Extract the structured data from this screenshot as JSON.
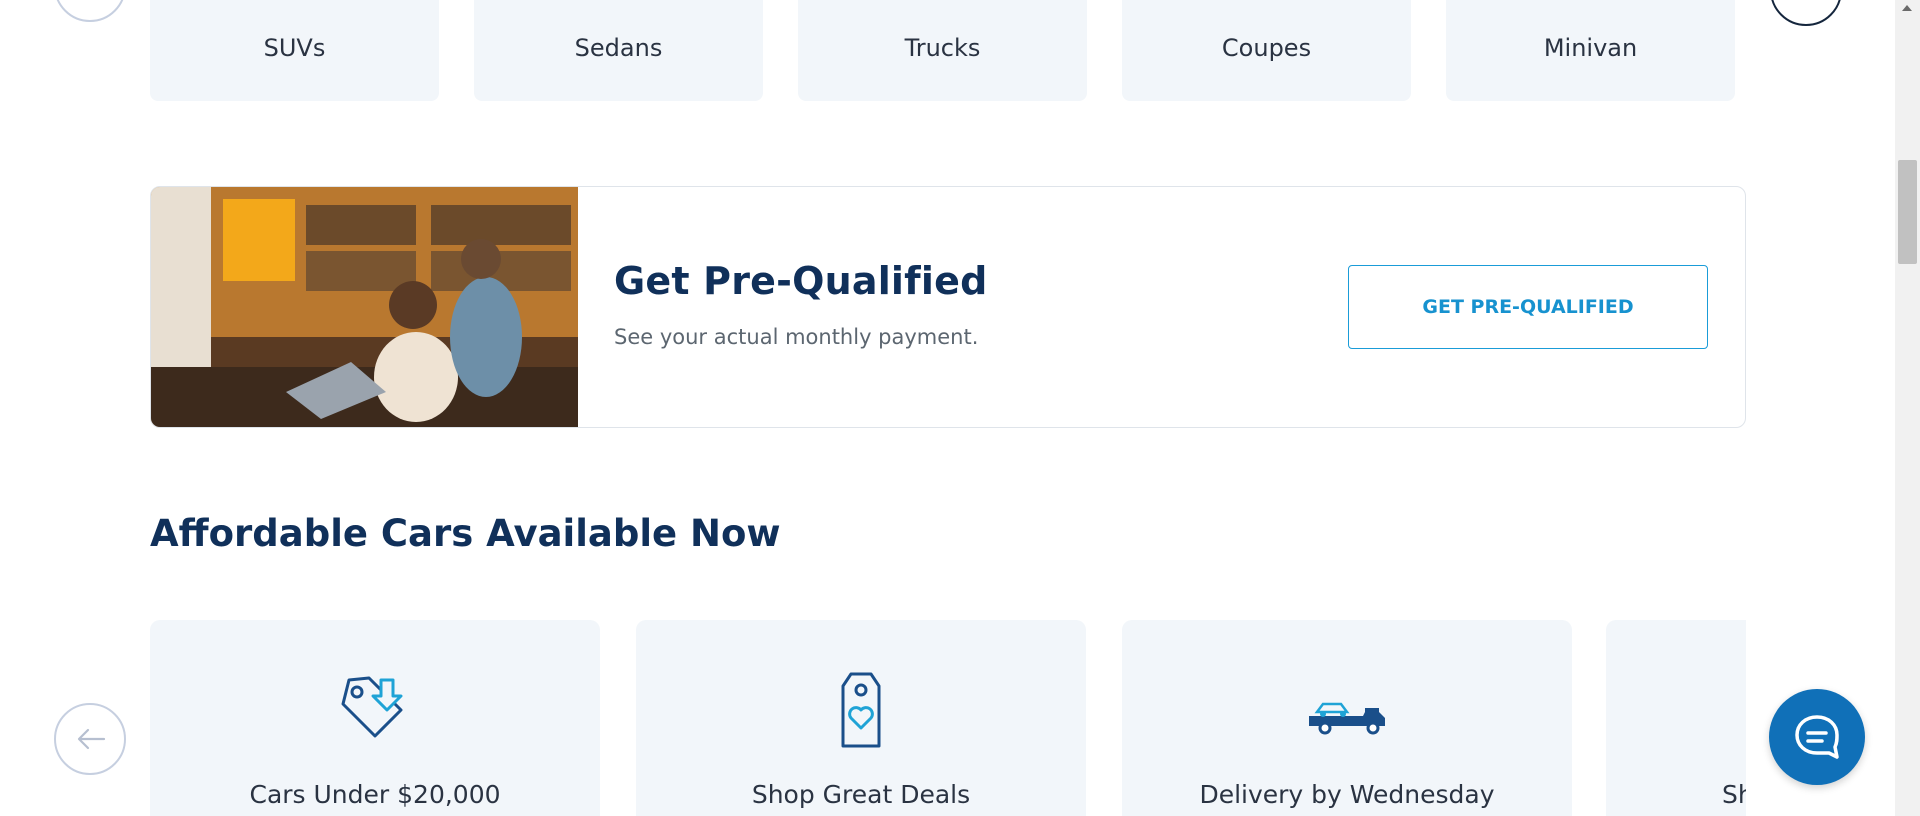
{
  "vehicle_types": [
    {
      "label": "SUVs"
    },
    {
      "label": "Sedans"
    },
    {
      "label": "Trucks"
    },
    {
      "label": "Coupes"
    },
    {
      "label": "Minivan"
    }
  ],
  "prequal_banner": {
    "title": "Get Pre-Qualified",
    "subtitle": "See your actual monthly payment.",
    "button_label": "GET PRE-QUALIFIED"
  },
  "affordable_section": {
    "title": "Affordable Cars Available Now",
    "cards": [
      {
        "label": "Cars Under $20,000",
        "icon": "price-tag-down-icon"
      },
      {
        "label": "Shop Great Deals",
        "icon": "heart-tag-icon"
      },
      {
        "label": "Delivery by Wednesday",
        "icon": "delivery-truck-icon"
      },
      {
        "label": "Sh",
        "icon": ""
      }
    ]
  },
  "colors": {
    "brand_navy": "#10305a",
    "accent_blue": "#1792cf",
    "chat_blue": "#1070b8",
    "card_bg": "#f2f6fa"
  }
}
